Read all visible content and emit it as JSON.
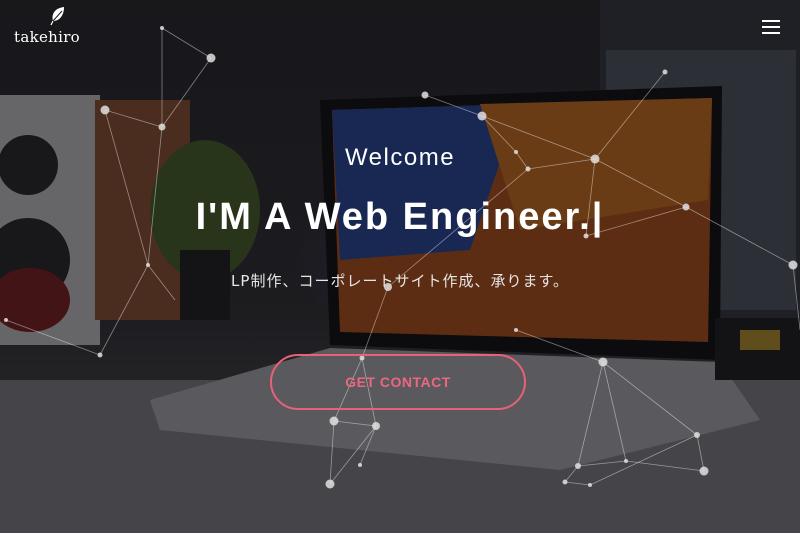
{
  "header": {
    "logo_text": "takehiro",
    "logo_icon": "leaf-icon",
    "menu_icon": "hamburger-menu-icon"
  },
  "hero": {
    "welcome": "Welcome",
    "headline": "I'M A Web Engineer.|",
    "subtitle": "LP制作、コーポレートサイト作成、承ります。",
    "cta_label": "GET CONTACT"
  },
  "colors": {
    "accent": "#e8607a",
    "text": "#ffffff",
    "overlay": "rgba(10,10,12,0.55)"
  }
}
